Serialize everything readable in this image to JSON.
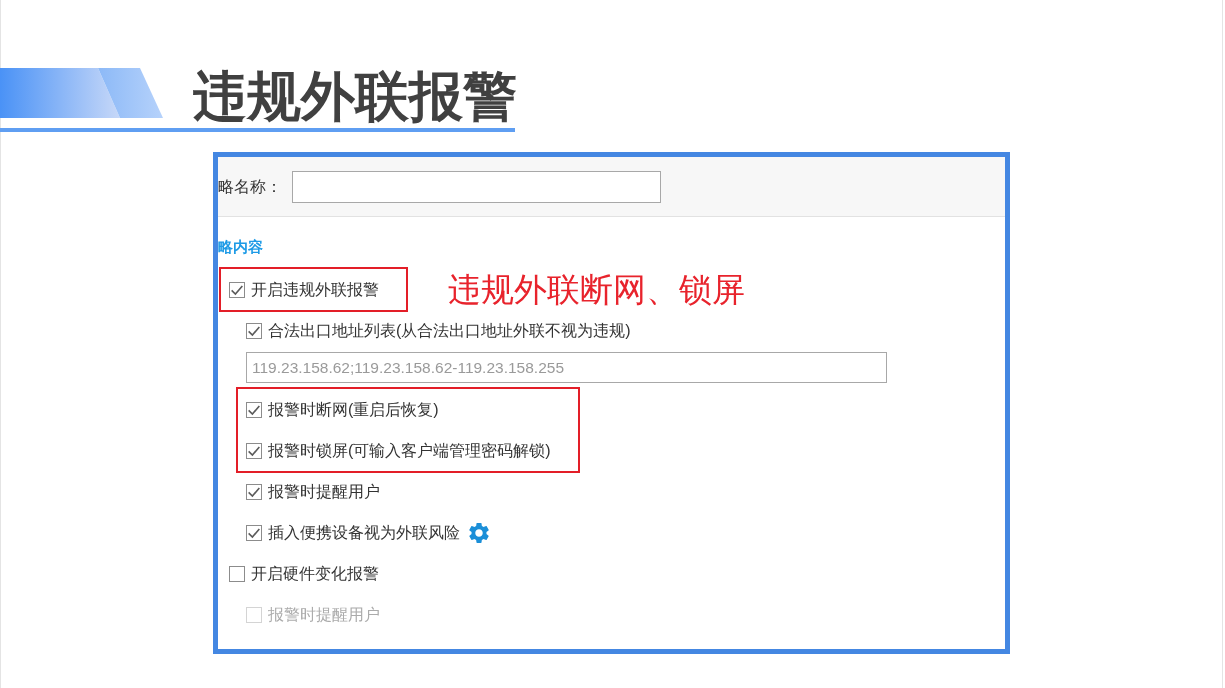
{
  "slide": {
    "title": "违规外联报警"
  },
  "screenshot": {
    "name_field": {
      "label": "略名称："
    },
    "section_title": "略内容",
    "options": [
      {
        "kind": "checkbox",
        "label": "开启违规外联报警",
        "checked": true,
        "disabled": false,
        "highlighted": true,
        "has_settings": false,
        "callout": "违规外联断网、锁屏",
        "children": [
          {
            "kind": "checkbox",
            "label": "合法出口地址列表(从合法出口地址外联不视为违规)",
            "checked": true,
            "disabled": false,
            "highlighted": false,
            "has_settings": false
          },
          {
            "kind": "field",
            "value": "119.23.158.62;119.23.158.62-119.23.158.255",
            "highlighted": false
          },
          {
            "kind": "checkbox",
            "label": "报警时断网(重启后恢复)",
            "checked": true,
            "disabled": false,
            "highlighted": true,
            "has_settings": false
          },
          {
            "kind": "checkbox",
            "label": "报警时锁屏(可输入客户端管理密码解锁)",
            "checked": true,
            "disabled": false,
            "highlighted": true,
            "has_settings": false
          },
          {
            "kind": "checkbox",
            "label": "报警时提醒用户",
            "checked": true,
            "disabled": false,
            "highlighted": false,
            "has_settings": false
          },
          {
            "kind": "checkbox",
            "label": "插入便携设备视为外联风险",
            "checked": true,
            "disabled": false,
            "highlighted": false,
            "has_settings": true
          }
        ]
      },
      {
        "kind": "checkbox",
        "label": "开启硬件变化报警",
        "checked": false,
        "disabled": false,
        "highlighted": false,
        "has_settings": false,
        "children": [
          {
            "kind": "checkbox",
            "label": "报警时提醒用户",
            "checked": false,
            "disabled": true,
            "highlighted": false,
            "has_settings": false
          }
        ]
      }
    ]
  }
}
